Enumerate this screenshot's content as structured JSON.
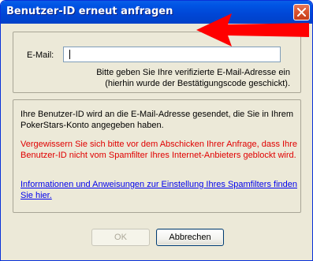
{
  "window": {
    "title": "Benutzer-ID erneut anfragen"
  },
  "form": {
    "email_label": "E-Mail:",
    "email_value": "",
    "hint_line1": "Bitte geben Sie Ihre verifizierte E-Mail-Adresse ein",
    "hint_line2": "(hierhin wurde der Bestätigungscode geschickt)."
  },
  "info": {
    "text1": "Ihre Benutzer-ID wird an die E-Mail-Adresse gesendet, die Sie in Ihrem PokerStars-Konto angegeben haben.",
    "warning": "Vergewissern Sie sich bitte vor dem Abschicken Ihrer Anfrage, dass Ihre Benutzer-ID nicht vom Spamfilter Ihres Internet-Anbieters geblockt wird.",
    "link": "Informationen und Anweisungen zur Einstellung Ihres Spamfilters finden Sie hier."
  },
  "buttons": {
    "ok": "OK",
    "cancel": "Abbrechen"
  },
  "colors": {
    "titlebar": "#0055e5",
    "warning_text": "#e00000",
    "link_text": "#0000ee",
    "annotation_arrow": "#ff0000"
  },
  "icons": {
    "close": "close-icon",
    "annotation": "red-arrow"
  }
}
